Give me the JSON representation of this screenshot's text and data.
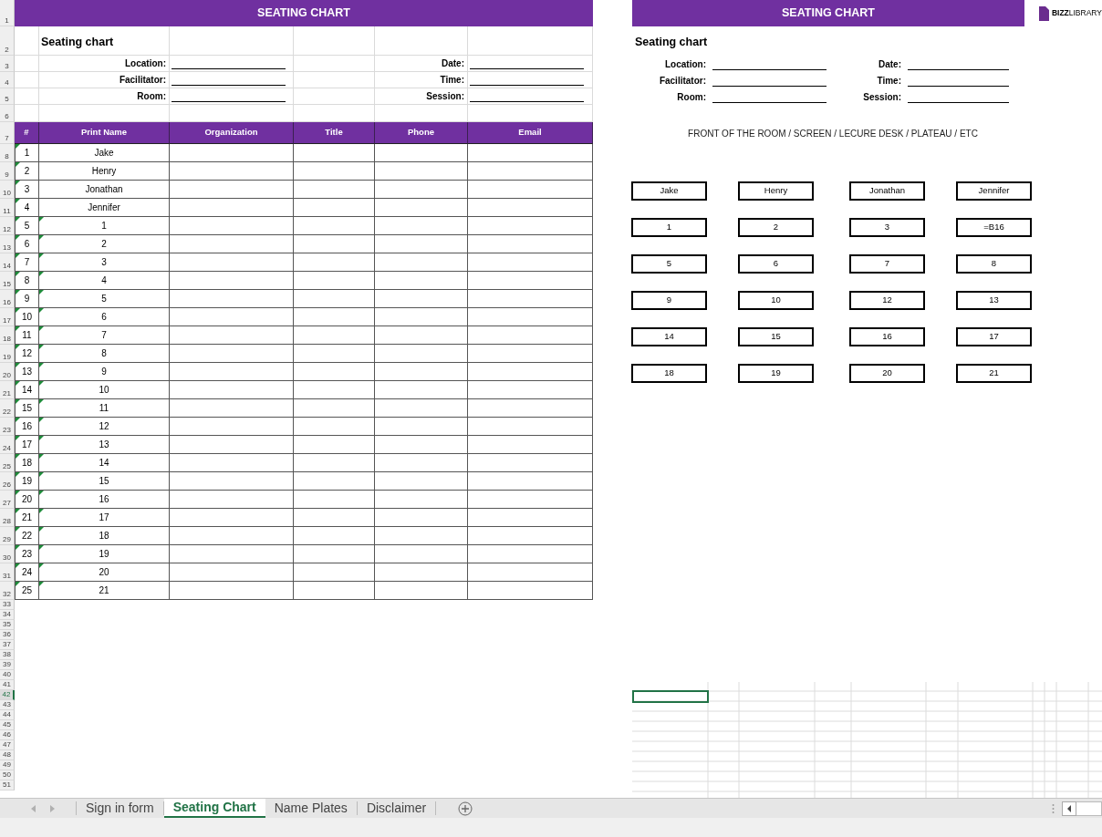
{
  "row_headers": [
    {
      "label": "1",
      "selected": false
    },
    {
      "label": "2",
      "selected": false
    },
    {
      "label": "3",
      "selected": false
    },
    {
      "label": "4",
      "selected": false
    },
    {
      "label": "5",
      "selected": false
    },
    {
      "label": "6",
      "selected": false
    },
    {
      "label": "7",
      "selected": false
    },
    {
      "label": "8",
      "selected": false
    },
    {
      "label": "9",
      "selected": false
    },
    {
      "label": "10",
      "selected": false
    },
    {
      "label": "11",
      "selected": false
    },
    {
      "label": "12",
      "selected": false
    },
    {
      "label": "13",
      "selected": false
    },
    {
      "label": "14",
      "selected": false
    },
    {
      "label": "15",
      "selected": false
    },
    {
      "label": "16",
      "selected": false
    },
    {
      "label": "17",
      "selected": false
    },
    {
      "label": "18",
      "selected": false
    },
    {
      "label": "19",
      "selected": false
    },
    {
      "label": "20",
      "selected": false
    },
    {
      "label": "21",
      "selected": false
    },
    {
      "label": "22",
      "selected": false
    },
    {
      "label": "23",
      "selected": false
    },
    {
      "label": "24",
      "selected": false
    },
    {
      "label": "25",
      "selected": false
    },
    {
      "label": "26",
      "selected": false
    },
    {
      "label": "27",
      "selected": false
    },
    {
      "label": "28",
      "selected": false
    },
    {
      "label": "29",
      "selected": false
    },
    {
      "label": "30",
      "selected": false
    },
    {
      "label": "31",
      "selected": false
    },
    {
      "label": "32",
      "selected": false
    },
    {
      "label": "33",
      "selected": false
    },
    {
      "label": "34",
      "selected": false
    },
    {
      "label": "35",
      "selected": false
    },
    {
      "label": "36",
      "selected": false
    },
    {
      "label": "37",
      "selected": false
    },
    {
      "label": "38",
      "selected": false
    },
    {
      "label": "39",
      "selected": false
    },
    {
      "label": "40",
      "selected": false
    },
    {
      "label": "41",
      "selected": false
    },
    {
      "label": "42",
      "selected": true
    },
    {
      "label": "43",
      "selected": false
    },
    {
      "label": "44",
      "selected": false
    },
    {
      "label": "45",
      "selected": false
    },
    {
      "label": "46",
      "selected": false
    },
    {
      "label": "47",
      "selected": false
    },
    {
      "label": "48",
      "selected": false
    },
    {
      "label": "49",
      "selected": false
    },
    {
      "label": "50",
      "selected": false
    },
    {
      "label": "51",
      "selected": false
    }
  ],
  "sheet": {
    "title": "SEATING CHART",
    "subtitle": "Seating chart",
    "fields_left": [
      {
        "label": "Location:"
      },
      {
        "label": "Facilitator:"
      },
      {
        "label": "Room:"
      }
    ],
    "fields_right": [
      {
        "label": "Date:"
      },
      {
        "label": "Time:"
      },
      {
        "label": "Session:"
      }
    ],
    "table": {
      "columns": [
        "#",
        "Print Name",
        "Organization",
        "Title",
        "Phone",
        "Email"
      ],
      "rows": [
        {
          "number": "1",
          "name": "Jake",
          "number_flagged": true,
          "name_flagged": false
        },
        {
          "number": "2",
          "name": "Henry",
          "number_flagged": true,
          "name_flagged": false
        },
        {
          "number": "3",
          "name": "Jonathan",
          "number_flagged": true,
          "name_flagged": false
        },
        {
          "number": "4",
          "name": "Jennifer",
          "number_flagged": true,
          "name_flagged": false
        },
        {
          "number": "5",
          "name": "1",
          "number_flagged": true,
          "name_flagged": true
        },
        {
          "number": "6",
          "name": "2",
          "number_flagged": true,
          "name_flagged": true
        },
        {
          "number": "7",
          "name": "3",
          "number_flagged": true,
          "name_flagged": true
        },
        {
          "number": "8",
          "name": "4",
          "number_flagged": true,
          "name_flagged": true
        },
        {
          "number": "9",
          "name": "5",
          "number_flagged": true,
          "name_flagged": true
        },
        {
          "number": "10",
          "name": "6",
          "number_flagged": true,
          "name_flagged": true
        },
        {
          "number": "11",
          "name": "7",
          "number_flagged": true,
          "name_flagged": true
        },
        {
          "number": "12",
          "name": "8",
          "number_flagged": true,
          "name_flagged": true
        },
        {
          "number": "13",
          "name": "9",
          "number_flagged": true,
          "name_flagged": true
        },
        {
          "number": "14",
          "name": "10",
          "number_flagged": true,
          "name_flagged": true
        },
        {
          "number": "15",
          "name": "11",
          "number_flagged": true,
          "name_flagged": true
        },
        {
          "number": "16",
          "name": "12",
          "number_flagged": true,
          "name_flagged": true
        },
        {
          "number": "17",
          "name": "13",
          "number_flagged": true,
          "name_flagged": true
        },
        {
          "number": "18",
          "name": "14",
          "number_flagged": true,
          "name_flagged": true
        },
        {
          "number": "19",
          "name": "15",
          "number_flagged": true,
          "name_flagged": true
        },
        {
          "number": "20",
          "name": "16",
          "number_flagged": true,
          "name_flagged": true
        },
        {
          "number": "21",
          "name": "17",
          "number_flagged": true,
          "name_flagged": true
        },
        {
          "number": "22",
          "name": "18",
          "number_flagged": true,
          "name_flagged": true
        },
        {
          "number": "23",
          "name": "19",
          "number_flagged": true,
          "name_flagged": true
        },
        {
          "number": "24",
          "name": "20",
          "number_flagged": true,
          "name_flagged": true
        },
        {
          "number": "25",
          "name": "21",
          "number_flagged": true,
          "name_flagged": true
        }
      ]
    }
  },
  "chart": {
    "title": "SEATING CHART",
    "logo": "**BIZZ**LIBRARY",
    "subtitle": "Seating chart",
    "fields_left": [
      {
        "label": "Location:"
      },
      {
        "label": "Facilitator:"
      },
      {
        "label": "Room:"
      }
    ],
    "fields_right": [
      {
        "label": "Date:"
      },
      {
        "label": "Time:"
      },
      {
        "label": "Session:"
      }
    ],
    "front_label": "FRONT OF THE ROOM / SCREEN / LECURE DESK / PLATEAU / ETC",
    "seats": [
      [
        "Jake",
        "Henry",
        "Jonathan",
        "Jennifer"
      ],
      [
        "1",
        "2",
        "3",
        "=B16"
      ],
      [
        "5",
        "6",
        "7",
        "8"
      ],
      [
        "9",
        "10",
        "12",
        "13"
      ],
      [
        "14",
        "15",
        "16",
        "17"
      ],
      [
        "18",
        "19",
        "20",
        "21"
      ]
    ]
  },
  "sheet_tabs": [
    {
      "label": "Sign in form",
      "selected": false
    },
    {
      "label": "Seating Chart",
      "selected": true
    },
    {
      "label": "Name Plates",
      "selected": false
    },
    {
      "label": "Disclaimer",
      "selected": false
    }
  ]
}
